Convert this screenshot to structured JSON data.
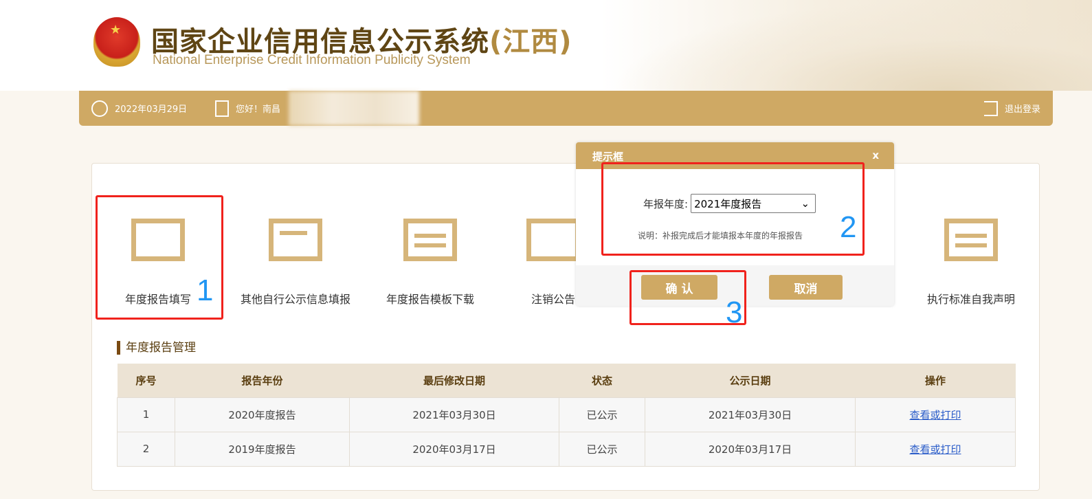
{
  "header": {
    "title_cn": "国家企业信用信息公示系统",
    "title_region": "(江西)",
    "title_en": "National Enterprise Credit Information Publicity System",
    "emblem_star": "★"
  },
  "topbar": {
    "date": "2022年03月29日",
    "greeting": "您好！南昌",
    "logout": "退出登录"
  },
  "tiles": [
    {
      "label": "年度报告填写"
    },
    {
      "label": "其他自行公示信息填报"
    },
    {
      "label": "年度报告模板下载"
    },
    {
      "label": "注销公告"
    },
    {
      "label": "执行标准自我声明"
    }
  ],
  "section_title": "年度报告管理",
  "table": {
    "headers": [
      "序号",
      "报告年份",
      "最后修改日期",
      "状态",
      "公示日期",
      "操作"
    ],
    "rows": [
      [
        "1",
        "2020年度报告",
        "2021年03月30日",
        "已公示",
        "2021年03月30日",
        "查看或打印"
      ],
      [
        "2",
        "2019年度报告",
        "2020年03月17日",
        "已公示",
        "2020年03月17日",
        "查看或打印"
      ]
    ]
  },
  "modal": {
    "title": "提示框",
    "close": "x",
    "field_label": "年报年度:",
    "selected": "2021年度报告",
    "chevron": "⌄",
    "note": "说明：补报完成后才能填报本年度的年报报告",
    "confirm": "确 认",
    "cancel": "取消"
  },
  "annotations": [
    "1",
    "2",
    "3"
  ]
}
